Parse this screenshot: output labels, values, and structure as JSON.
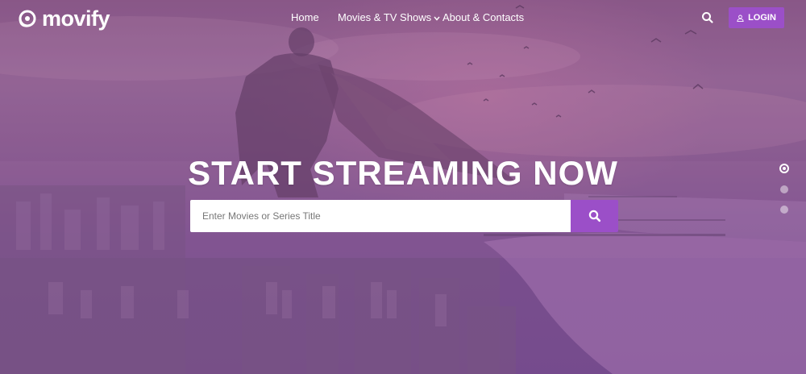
{
  "brand": {
    "name": "movify"
  },
  "nav": {
    "items": [
      {
        "label": "Home"
      },
      {
        "label": "Movies & TV Shows",
        "has_dropdown": true
      },
      {
        "label": "About & Contacts"
      }
    ]
  },
  "header": {
    "login_label": "LOGIN"
  },
  "hero": {
    "headline": "START STREAMING NOW",
    "search_placeholder": "Enter Movies or Series Title"
  },
  "slider": {
    "slides": 3,
    "active_index": 0
  },
  "colors": {
    "accent": "#9b4fc8",
    "overlay": "#7d4f8f"
  },
  "icons": [
    "movify-logo-icon",
    "search-icon",
    "user-icon",
    "chevron-down-icon"
  ]
}
